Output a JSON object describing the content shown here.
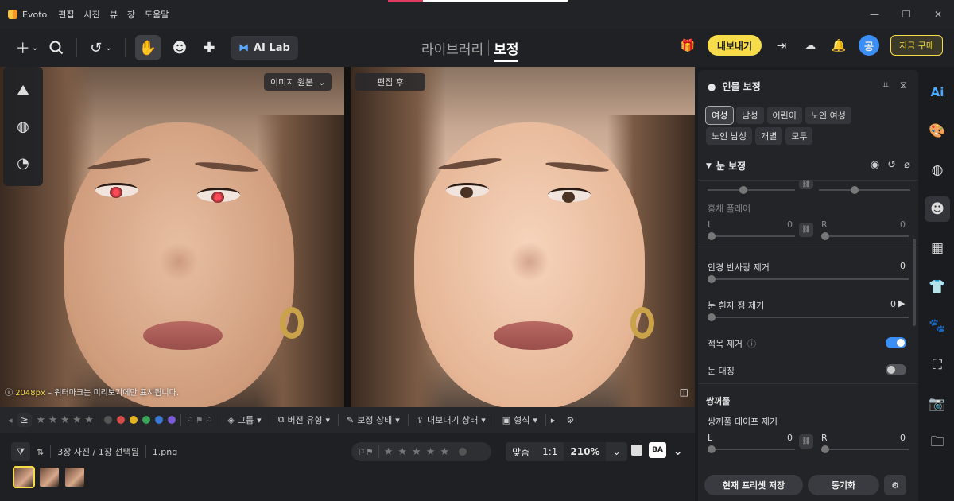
{
  "app": {
    "name": "Evoto",
    "menus": [
      "편집",
      "사진",
      "뷰",
      "창",
      "도움말"
    ]
  },
  "window": {
    "minimize": "—",
    "restore": "❐",
    "close": "✕"
  },
  "toolbar": {
    "add_icon": "plus-icon",
    "ai_lab_label": "AI Lab",
    "mode_tabs": [
      {
        "label": "라이브러리",
        "active": false
      },
      {
        "label": "보정",
        "active": true
      }
    ],
    "export_label": "내보내기",
    "avatar_initial": "공",
    "buy_label": "지금 구매"
  },
  "canvas": {
    "before_label": "이미지 원본",
    "after_label": "편집 후",
    "watermark_px": "2048px",
    "watermark_note": " – 워터마크는 미리보기에만 표시됩니다."
  },
  "filterbar": {
    "ge_symbol": "≥",
    "stars": [
      "★",
      "★",
      "★",
      "★",
      "★"
    ],
    "colors": [
      "#555555",
      "#d94a4a",
      "#e6b422",
      "#3aa55a",
      "#3a7ad6",
      "#7a5ad6"
    ],
    "group": "그룹",
    "version_type": "버전 유형",
    "edit_status": "보정 상태",
    "export_status": "내보내기 상태",
    "format": "형식"
  },
  "bottombar": {
    "count_label": "3장 사진 / 1장 선택됨",
    "filename": "1.png",
    "fit_label": "맞춤",
    "one_to_one": "1:1",
    "zoom_value": "210%",
    "ba_label": "BA",
    "thumbnails": [
      {
        "selected": true
      },
      {
        "selected": false
      },
      {
        "selected": false
      }
    ]
  },
  "panel": {
    "title": "인물 보정",
    "gender_chips": [
      {
        "label": "여성",
        "active": true
      },
      {
        "label": "남성",
        "active": false
      },
      {
        "label": "어린이",
        "active": false
      },
      {
        "label": "노인 여성",
        "active": false
      },
      {
        "label": "노인 남성",
        "active": false
      },
      {
        "label": "개별",
        "active": false
      },
      {
        "label": "모두",
        "active": false
      }
    ],
    "section_eye": "눈 보정",
    "iris_flare": {
      "label": "홍채 플레어",
      "left_label": "L",
      "left_value": "0",
      "right_label": "R",
      "right_value": "0"
    },
    "glasses_glare": {
      "label": "안경 반사광 제거",
      "value": "0"
    },
    "eye_white": {
      "label": "눈 흰자 점 제거",
      "value": "0"
    },
    "red_eye": {
      "label": "적목 제거",
      "enabled": true
    },
    "eye_symmetry": {
      "label": "눈 대칭",
      "enabled": false
    },
    "section_double_eyelid": "쌍꺼풀",
    "eyelid_tape": {
      "label": "쌍꺼풀 테이프 제거",
      "left_label": "L",
      "left_value": "0",
      "right_label": "R",
      "right_value": "0"
    },
    "save_preset": "현재 프리셋 저장",
    "sync": "동기화"
  },
  "colors": {
    "accent_yellow": "#f7dc4a",
    "accent_blue": "#3a8ef6",
    "panel_bg": "#232428"
  }
}
